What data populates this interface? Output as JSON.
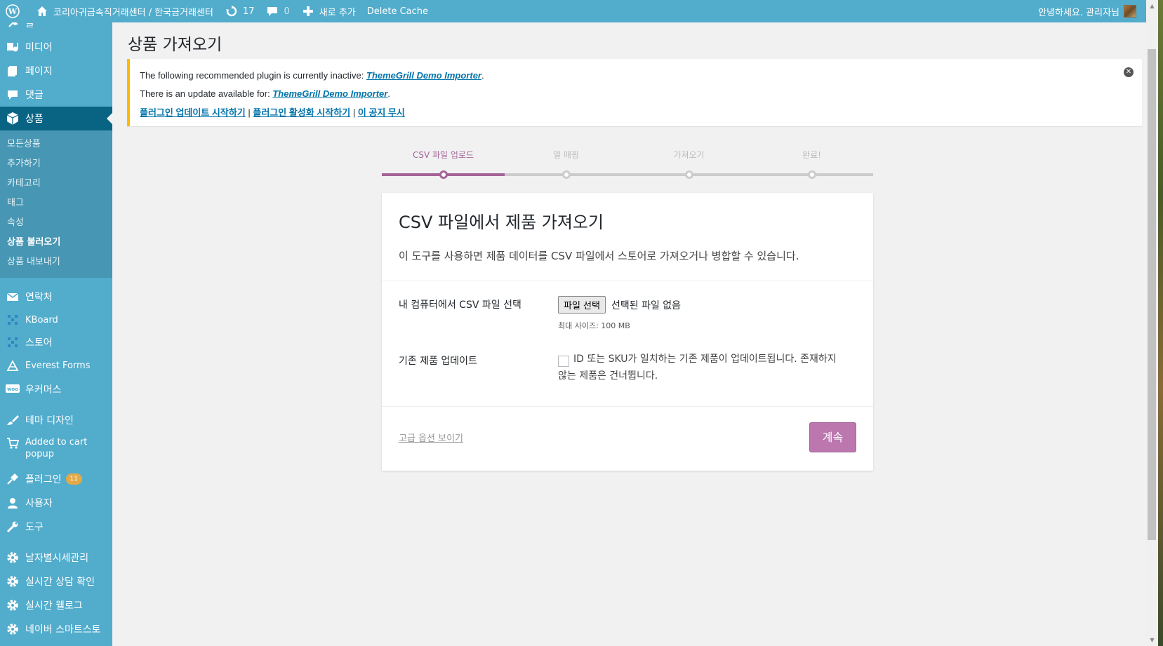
{
  "adminbar": {
    "site_name": "코리아귀금속직거래센터 / 한국금거래센터",
    "updates_count": "17",
    "comments_count": "0",
    "new_label": "새로 추가",
    "delete_cache": "Delete Cache",
    "greeting": "안녕하세요. 관리자님"
  },
  "sidebar": {
    "top_partial": "글",
    "items_top": [
      {
        "label": "미디어",
        "icon": "media-icon"
      },
      {
        "label": "페이지",
        "icon": "page-icon"
      },
      {
        "label": "댓글",
        "icon": "comment-icon"
      }
    ],
    "current": {
      "label": "상품",
      "icon": "product-box-icon"
    },
    "submenu": [
      "모든상품",
      "추가하기",
      "카테고리",
      "태그",
      "속성",
      "상품 불러오기",
      "상품 내보내기"
    ],
    "submenu_active": "상품 불러오기",
    "items_mid": [
      {
        "label": "연락처",
        "icon": "mail-icon"
      },
      {
        "label": "KBoard",
        "icon": "kboard-icon"
      },
      {
        "label": "스토어",
        "icon": "store-icon"
      },
      {
        "label": "Everest Forms",
        "icon": "everest-forms-icon"
      },
      {
        "label": "우커머스",
        "icon": "woo-icon"
      }
    ],
    "items_bottom": [
      {
        "label": "테마 디자인",
        "icon": "brush-icon"
      },
      {
        "label": "Added to cart popup",
        "icon": "cart-icon"
      },
      {
        "label": "플러그인",
        "icon": "plugin-icon",
        "badge": "11"
      },
      {
        "label": "사용자",
        "icon": "user-icon"
      },
      {
        "label": "도구",
        "icon": "wrench-icon"
      }
    ],
    "items_custom": [
      {
        "label": "날자별시세관리",
        "icon": "gear-icon"
      },
      {
        "label": "실시간 상담 확인",
        "icon": "gear-icon"
      },
      {
        "label": "실시간 웰로그",
        "icon": "gear-icon"
      },
      {
        "label": "네이버 스마트스토",
        "icon": "gear-icon"
      }
    ]
  },
  "page": {
    "title": "상품 가져오기"
  },
  "notice": {
    "line1_text": "The following recommended plugin is currently inactive: ",
    "line1_link": "ThemeGrill Demo Importer",
    "line2_text": "There is an update available for: ",
    "line2_link": "ThemeGrill Demo Importer",
    "action_update": "플러그인 업데이트 시작하기",
    "action_activate": "플러그인 활성화 시작하기",
    "action_dismiss": "이 공지 무시",
    "separator": "|"
  },
  "steps": [
    {
      "label": "CSV 파일 업로드",
      "active": true
    },
    {
      "label": "열 매핑",
      "active": false
    },
    {
      "label": "가져오기",
      "active": false
    },
    {
      "label": "완료!",
      "active": false
    }
  ],
  "progress_fraction": 0.25,
  "card": {
    "title": "CSV 파일에서 제품 가져오기",
    "description": "이 도구를 사용하면 제품 데이터를 CSV 파일에서 스토어로 가져오거나 병합할 수 있습니다.",
    "file_label": "내 컴퓨터에서 CSV 파일 선택",
    "file_button": "파일 선택",
    "file_none": "선택된 파일 없음",
    "max_size": "최대 사이즈: 100 MB",
    "update_label": "기존 제품 업데이트",
    "update_checkbox_text": "ID 또는 SKU가 일치하는 기존 제품이 업데이트됩니다. 존재하지 않는 제품은 건너뜁니다.",
    "advanced_link": "고급 옵션 보이기",
    "continue_button": "계속"
  },
  "colors": {
    "admin_blue": "#52accc",
    "current_menu": "#096484",
    "woo_purple": "#a46497",
    "notice_border": "#ffb900"
  }
}
